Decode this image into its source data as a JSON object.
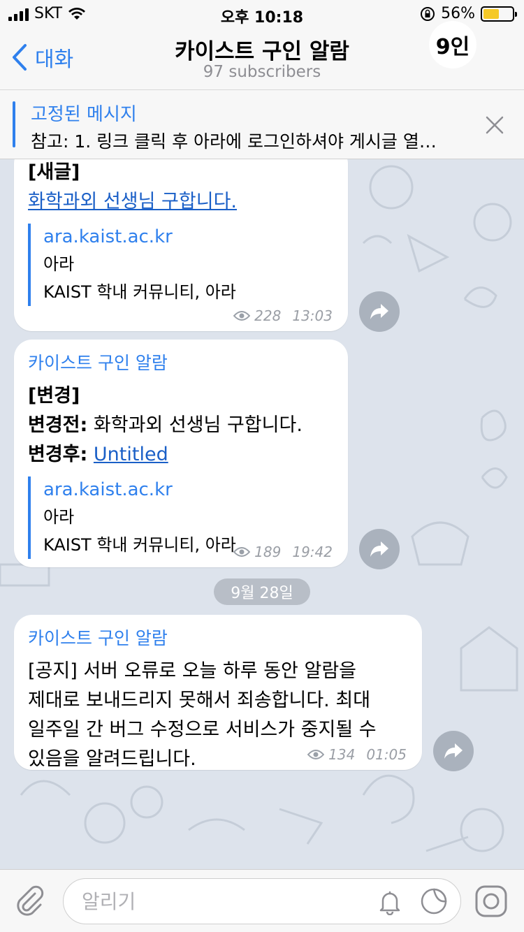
{
  "status": {
    "carrier": "SKT",
    "time": "오후 10:18",
    "battery": "56%",
    "battery_level": 0.56
  },
  "nav": {
    "back_label": "대화",
    "title": "카이스트 구인 알람",
    "subtitle": "97 subscribers",
    "avatar_text": "9인"
  },
  "pinned": {
    "title": "고정된 메시지",
    "text": "참고: 1. 링크 클릭 후 아라에 로그인하셔야 게시글 열…"
  },
  "messages": [
    {
      "tag": "[새글]",
      "link": "화학과외 선생님 구합니다.",
      "preview_site": "ara.kaist.ac.kr",
      "preview_title": "아라",
      "preview_desc": "KAIST 학내 커뮤니티, 아라",
      "views": "228",
      "time": "13:03"
    },
    {
      "sender": "카이스트 구인 알람",
      "tag": "[변경]",
      "before_label": "변경전:",
      "before_value": " 화학과외 선생님 구합니다.",
      "after_label": "변경후:",
      "after_value": "Untitled",
      "preview_site": "ara.kaist.ac.kr",
      "preview_title": "아라",
      "preview_desc": "KAIST 학내 커뮤니티, 아라",
      "views": "189",
      "time": "19:42"
    },
    {
      "sender": "카이스트 구인 알람",
      "lines": [
        "[공지] 서버 오류로 오늘 하루 동안 알람을",
        "제대로 보내드리지 못해서 죄송합니다. 최대",
        "일주일 간 버그 수정으로 서비스가 중지될 수",
        "있음을 알려드립니다."
      ],
      "views": "134",
      "time": "01:05"
    }
  ],
  "date_separator": "9월 28일",
  "composer": {
    "placeholder": "알리기"
  },
  "colors": {
    "accent": "#2f80ed",
    "chat_bg": "#dde3ec",
    "battery": "#f5c928"
  }
}
